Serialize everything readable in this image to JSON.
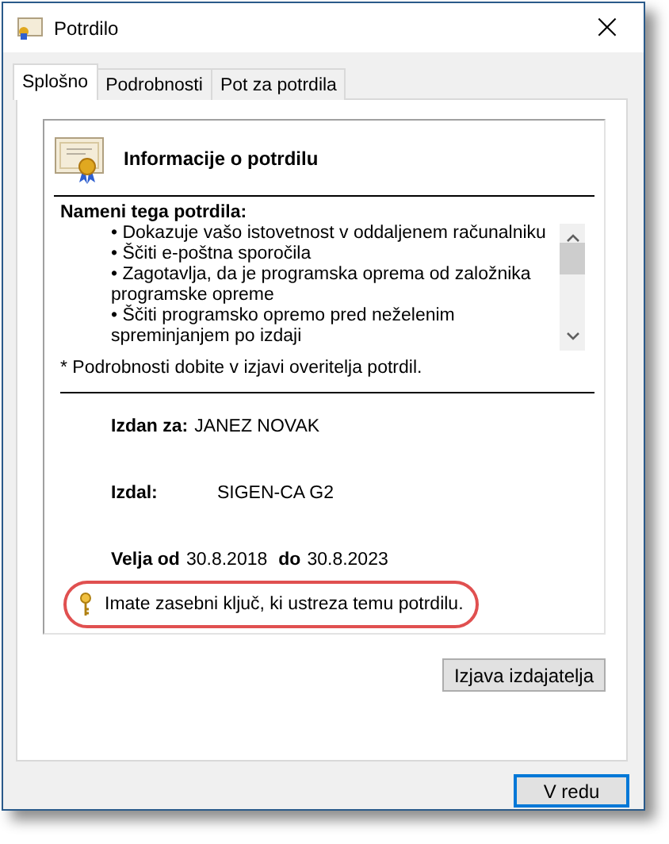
{
  "window": {
    "title": "Potrdilo",
    "close": "×"
  },
  "tabs": [
    {
      "label": "Splošno",
      "selected": true
    },
    {
      "label": "Podrobnosti",
      "selected": false
    },
    {
      "label": "Pot za potrdila",
      "selected": false
    }
  ],
  "info": {
    "heading": "Informacije o potrdilu",
    "purposes_title": "Nameni tega potrdila:",
    "purposes": [
      "• Dokazuje vašo istovetnost v oddaljenem računalniku",
      "• Ščiti e-poštna sporočila",
      "• Zagotavlja, da je programska oprema od založnika programske opreme",
      "• Ščiti programsko opremo pred neželenim spreminjanjem po izdaji"
    ],
    "footnote": "* Podrobnosti dobite v izjavi overitelja potrdil.",
    "issued_to": {
      "label": "Izdan za:",
      "value": "JANEZ NOVAK"
    },
    "issued_by": {
      "label": "Izdal:",
      "value": "SIGEN-CA G2"
    },
    "valid": {
      "from_label": "Velja od",
      "from": "30.8.2018",
      "to_label": "do",
      "to": "30.8.2023"
    },
    "key_note": {
      "text": "Imate zasebni ključ, ki ustreza temu potrdilu.",
      "highlighted": true
    }
  },
  "statement_button": "Izjava izdajatelja",
  "ok_button": {
    "label": "V redu",
    "focused": true
  }
}
